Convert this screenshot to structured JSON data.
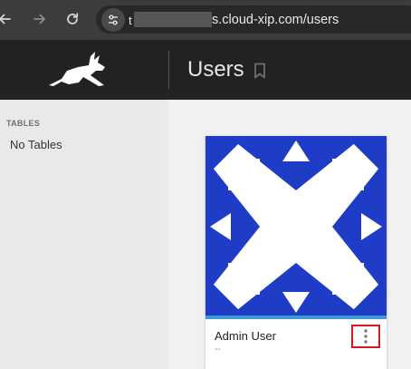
{
  "browser": {
    "url_prefix": "t",
    "url": "s.cloud-xip.com/users"
  },
  "header": {
    "title": "Users"
  },
  "sidebar": {
    "heading": "TABLES",
    "empty_text": "No Tables"
  },
  "users": [
    {
      "name": "Admin User",
      "subtitle": "--"
    }
  ],
  "icons": {
    "back": "arrow-left-icon",
    "forward": "arrow-right-icon",
    "reload": "reload-icon",
    "site_info": "tune-icon",
    "logo": "jumping-hare-logo",
    "bookmark": "bookmark-icon",
    "menu": "more-vert-icon"
  },
  "colors": {
    "browser_bar": "#3c3c3c",
    "app_header": "#222222",
    "sidebar_bg": "#e9e9e9",
    "main_bg": "#f1f1f1",
    "avatar_blue": "#1f3cc7",
    "card_accent": "#3f9ad6",
    "highlight_box": "#d7191c"
  }
}
